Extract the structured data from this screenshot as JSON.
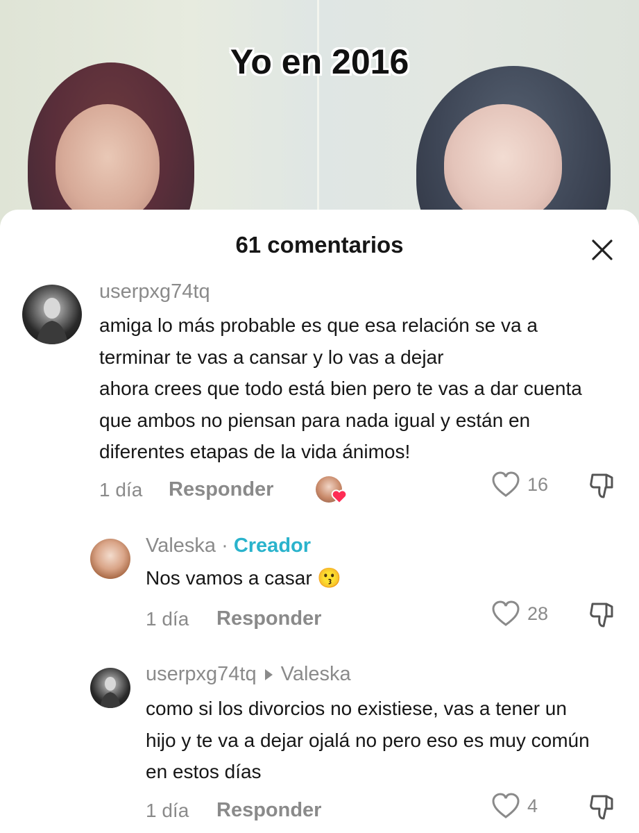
{
  "video": {
    "overlay_text": "Yo en 2016"
  },
  "panel": {
    "title": "61 comentarios",
    "close_icon": "close-icon"
  },
  "comments": [
    {
      "username": "userpxg74tq",
      "text_lines": [
        "amiga lo más probable es que esa relación se va a",
        "terminar te vas a cansar y lo vas a dejar",
        "ahora crees que todo está bien pero te vas a dar cuenta",
        "que ambos no piensan para nada igual y están en",
        "diferentes etapas de la vida ánimos!"
      ],
      "time": "1 día",
      "reply_label": "Responder",
      "likes": "16",
      "creator_liked": true
    },
    {
      "username": "Valeska",
      "separator": "·",
      "badge": "Creador",
      "text": "Nos vamos a casar 😗",
      "time": "1 día",
      "reply_label": "Responder",
      "likes": "28"
    },
    {
      "username": "userpxg74tq",
      "reply_to": "Valeska",
      "text_lines": [
        "como si los divorcios no existiese, vas a tener un",
        "hijo y te va a dejar ojalá no pero eso es muy común",
        "en estos días"
      ],
      "time": "1 día",
      "reply_label": "Responder",
      "likes": "4"
    }
  ],
  "colors": {
    "accent_creator": "#2ab3cc",
    "like_heart": "#fe2c55",
    "muted": "#8a8a8a"
  }
}
